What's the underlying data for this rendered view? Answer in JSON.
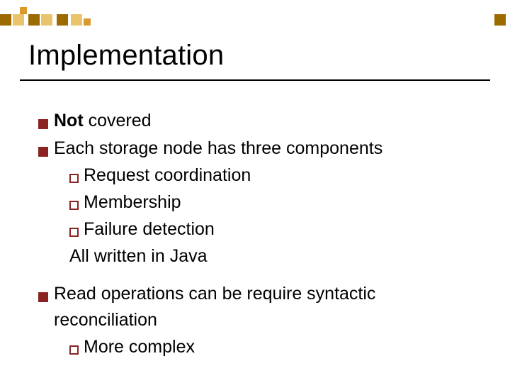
{
  "title": "Implementation",
  "items": [
    {
      "bold": "Not",
      "rest": " covered"
    },
    {
      "text": "Each storage node has three components",
      "children": [
        "Request coordination",
        "Membership",
        "Failure detection"
      ],
      "tail": "All written in Java"
    },
    {
      "text": "Read operations can be require syntactic reconciliation",
      "children": [
        "More complex"
      ]
    }
  ],
  "colors": {
    "bullet_fill": "#8b2323",
    "deco_dark": "#9c6a00",
    "deco_light": "#e9c46a",
    "deco_mid": "#d99a2b"
  }
}
